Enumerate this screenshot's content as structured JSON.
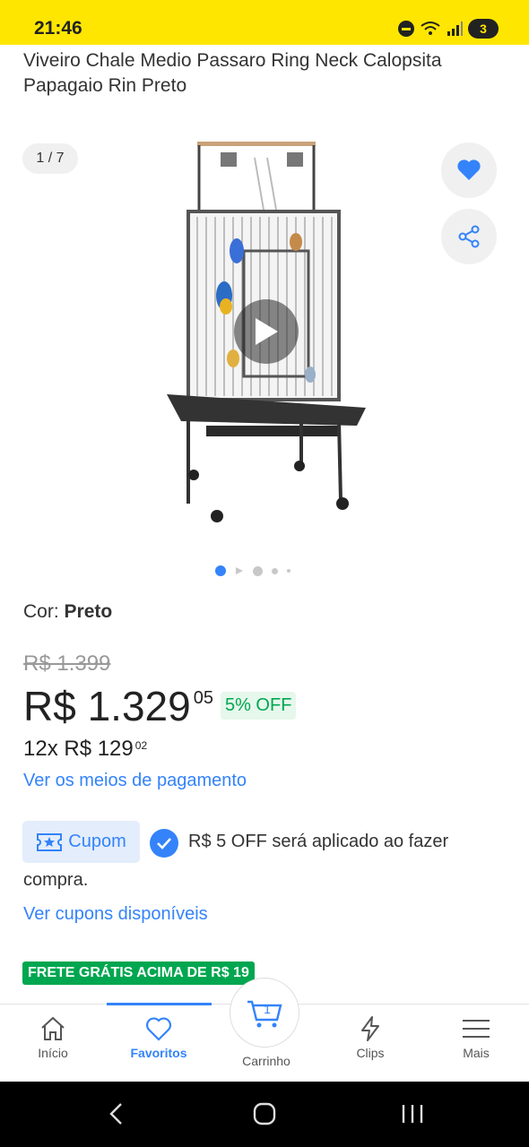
{
  "status_bar": {
    "time": "21:46",
    "battery": "3"
  },
  "product": {
    "title": "Viveiro Chale Medio Passaro Ring Neck Calopsita Papagaio Rin Preto",
    "image_counter": "1 / 7"
  },
  "variant": {
    "label": "Cor: ",
    "value": "Preto"
  },
  "pricing": {
    "old_price": "R$ 1.399",
    "price_main": "R$ 1.329",
    "price_cents": "05",
    "discount": "5% OFF",
    "installments_main": "12x R$ 129",
    "installments_cents": "02",
    "payment_link": "Ver os meios de pagamento"
  },
  "coupon": {
    "chip_label": "Cupom",
    "applied_text_line1": "R$ 5 OFF será aplicado ao fazer",
    "applied_text_line2": "compra.",
    "link": "Ver cupons disponíveis"
  },
  "shipping_badge": "FRETE GRÁTIS ACIMA DE R$ 19",
  "bottom_nav": {
    "items": [
      {
        "label": "Início",
        "icon": "home-icon"
      },
      {
        "label": "Favoritos",
        "icon": "heart-icon",
        "active": true
      },
      {
        "label": "Carrinho",
        "icon": "cart-icon",
        "badge": "1"
      },
      {
        "label": "Clips",
        "icon": "bolt-icon"
      },
      {
        "label": "Mais",
        "icon": "menu-icon"
      }
    ]
  },
  "colors": {
    "status_bar": "#ffe600",
    "accent_blue": "#3483fa",
    "success_green": "#00a650"
  }
}
